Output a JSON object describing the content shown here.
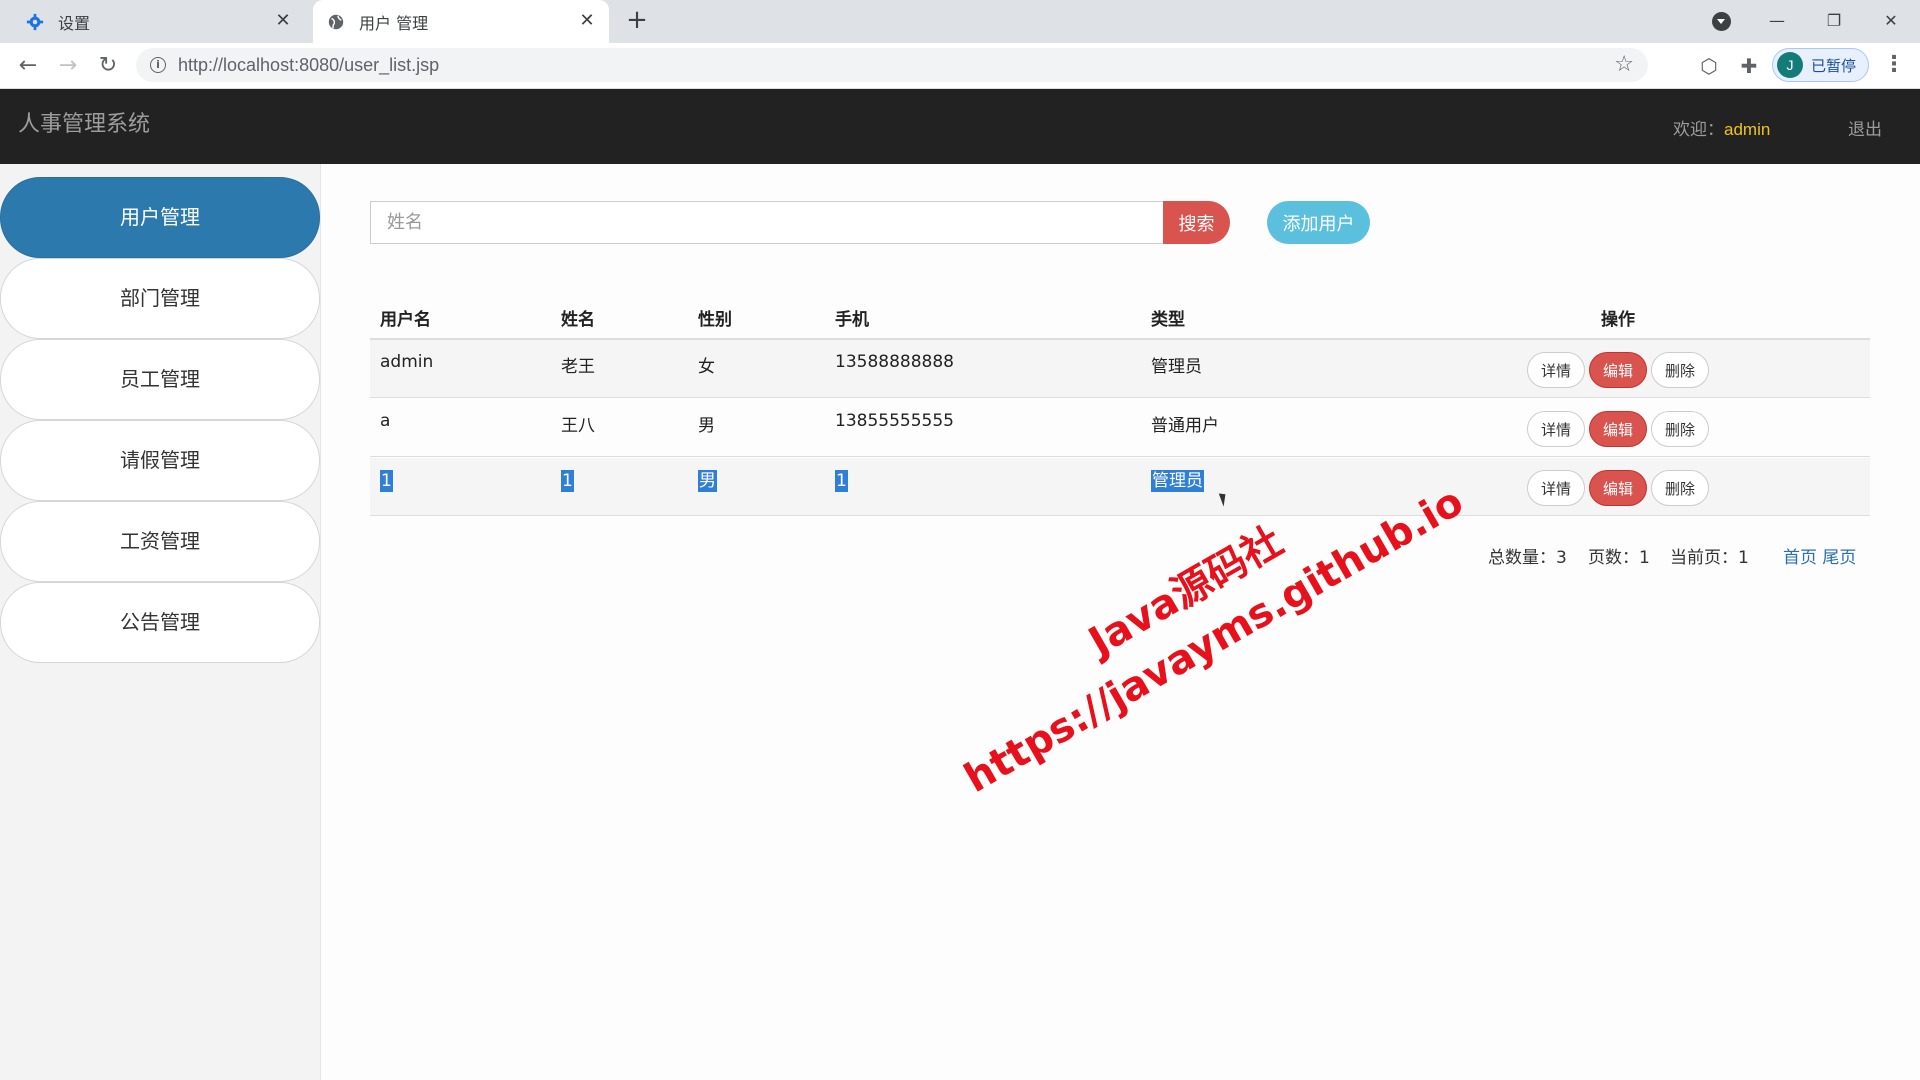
{
  "browser": {
    "tabs": [
      {
        "title": "设置",
        "icon": "gear-icon"
      },
      {
        "title": "用户 管理",
        "icon": "globe-icon"
      }
    ],
    "url_host": "http://localhost",
    "url_path": ":8080/user_list.jsp",
    "profile_initial": "J",
    "profile_status": "已暂停"
  },
  "header": {
    "brand": "人事管理系统",
    "welcome_label": "欢迎：",
    "username": "admin",
    "logout": "退出"
  },
  "sidebar": {
    "items": [
      {
        "label": "用户管理",
        "active": true
      },
      {
        "label": "部门管理"
      },
      {
        "label": "员工管理"
      },
      {
        "label": "请假管理"
      },
      {
        "label": "工资管理"
      },
      {
        "label": "公告管理"
      }
    ]
  },
  "search": {
    "placeholder": "姓名",
    "button": "搜索",
    "add_button": "添加用户"
  },
  "table": {
    "headers": [
      "用户名",
      "姓名",
      "性别",
      "手机",
      "类型",
      "操作"
    ],
    "rows": [
      {
        "username": "admin",
        "name": "老王",
        "gender": "女",
        "phone": "13588888888",
        "type": "管理员"
      },
      {
        "username": "a",
        "name": "王八",
        "gender": "男",
        "phone": "13855555555",
        "type": "普通用户"
      },
      {
        "username": "1",
        "name": "1",
        "gender": "男",
        "phone": "1",
        "type": "管理员"
      }
    ],
    "actions": {
      "detail": "详情",
      "edit": "编辑",
      "delete": "删除"
    }
  },
  "pagination": {
    "total_label": "总数量：",
    "total": "3",
    "pages_label": "页数：",
    "pages": "1",
    "current_label": "当前页：",
    "current": "1",
    "first": "首页",
    "last": "尾页"
  },
  "watermark": {
    "line1": "Java源码社",
    "line2": "https://javayms.github.io"
  },
  "colors": {
    "header_bg": "#222222",
    "sidebar_active": "#2c7aad",
    "danger": "#d9534f",
    "info": "#5bc0de",
    "username_highlight": "#f0c419",
    "watermark": "#e8101a"
  }
}
